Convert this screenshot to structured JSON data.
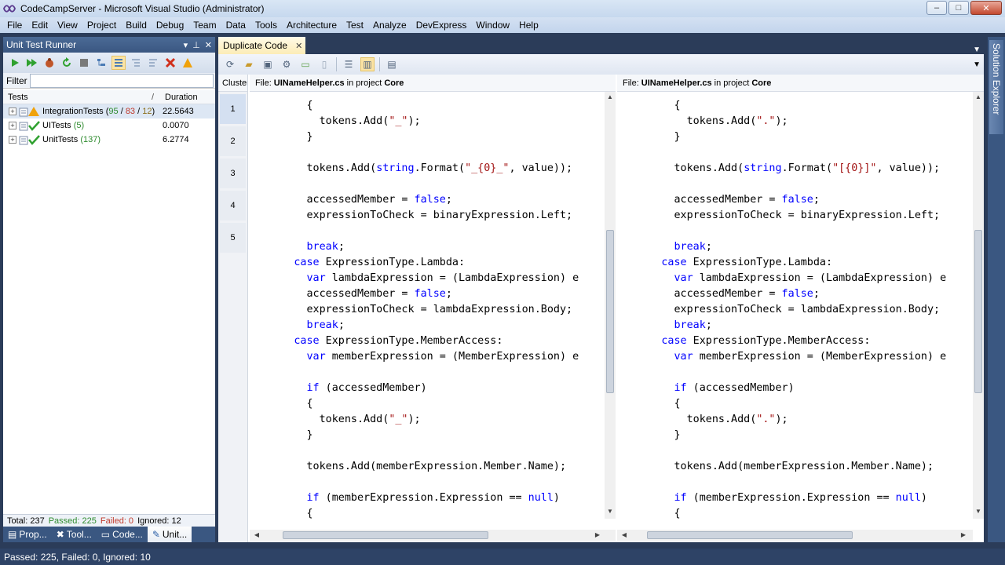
{
  "window": {
    "title": "CodeCampServer - Microsoft Visual Studio (Administrator)",
    "minimize": "–",
    "maximize": "□",
    "close": "✕"
  },
  "menu": [
    "File",
    "Edit",
    "View",
    "Project",
    "Build",
    "Debug",
    "Team",
    "Data",
    "Tools",
    "Architecture",
    "Test",
    "Analyze",
    "DevExpress",
    "Window",
    "Help"
  ],
  "test_runner": {
    "title": "Unit Test Runner",
    "filter_label": "Filter",
    "filter_value": "",
    "col_tests": "Tests",
    "col_sort": "/",
    "col_duration": "Duration",
    "rows": [
      {
        "name": "IntegrationTests",
        "passed": "95",
        "failed": "83",
        "ignored": "12",
        "duration": "22.5643"
      },
      {
        "name": "UITests",
        "count": "(5)",
        "duration": "0.0070"
      },
      {
        "name": "UnitTests",
        "count": "(137)",
        "duration": "6.2774"
      }
    ],
    "summary": {
      "total": "Total: 237",
      "passed": "Passed: 225",
      "failed": "Failed: 0",
      "ignored": "Ignored: 12"
    }
  },
  "bottom_tabs": [
    "Prop...",
    "Tool...",
    "Code...",
    "Unit..."
  ],
  "status_bar": "Passed: 225, Failed: 0, Ignored: 10",
  "document": {
    "tab_title": "Duplicate Code",
    "clusters_header": "Clusters",
    "clusters": [
      "1",
      "2",
      "3",
      "4",
      "5"
    ],
    "left_file": {
      "prefix": "File:",
      "name": "UINameHelper.cs",
      "mid": "in project",
      "project": "Core"
    },
    "right_file": {
      "prefix": "File:",
      "name": "UINameHelper.cs",
      "mid": "in project",
      "project": "Core"
    }
  },
  "side_panel": {
    "solution_explorer": "Solution Explorer"
  },
  "colors": {
    "accent": "#3a5781",
    "keyword": "#0000ff",
    "string": "#a31515",
    "passed": "#2e8b2e",
    "failed": "#c0392b"
  }
}
